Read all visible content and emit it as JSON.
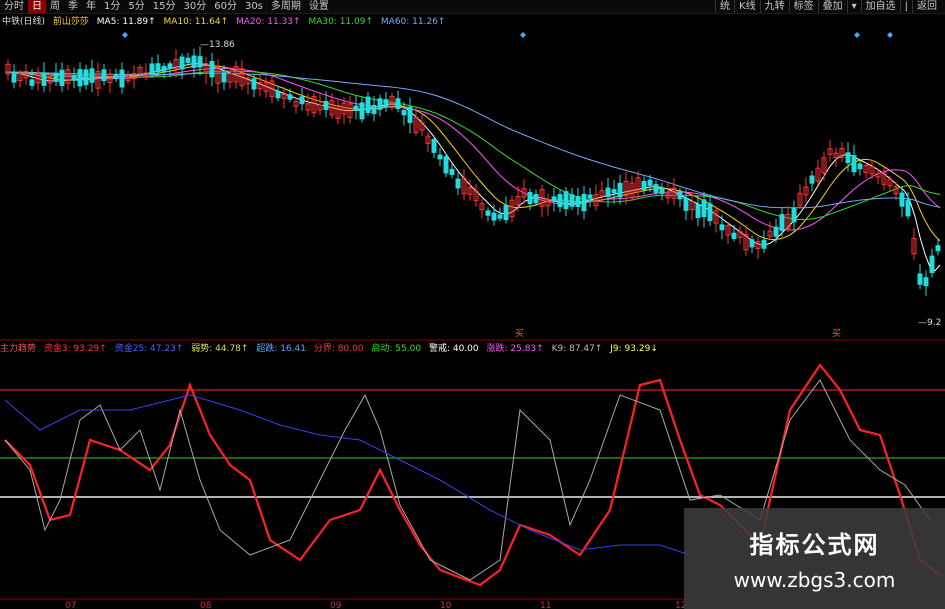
{
  "toolbar": {
    "items": [
      "分时",
      "日",
      "周",
      "季",
      "年",
      "1分",
      "5分",
      "15分",
      "30分",
      "60分",
      "30s",
      "多周期",
      "设置"
    ],
    "active_index": 1,
    "right_items": [
      "统",
      "K线",
      "九转",
      "标签",
      "叠加",
      "▾",
      "加自选",
      "|",
      "返回"
    ]
  },
  "main_legend": {
    "title": "中铁(日线)",
    "indicator": "前山莎莎",
    "ma": [
      {
        "label": "MA5: 11.89↑",
        "color": "#ffffff"
      },
      {
        "label": "MA10: 11.64↑",
        "color": "#ffd700"
      },
      {
        "label": "MA20: 11.33↑",
        "color": "#ff55ff"
      },
      {
        "label": "MA30: 11.09↑",
        "color": "#33dd33"
      },
      {
        "label": "MA60: 11.26↑",
        "color": "#77aaff"
      }
    ]
  },
  "price_labels": {
    "high": "13.86",
    "low": "9.2"
  },
  "markers": {
    "buy1": "买",
    "buy2": "买"
  },
  "sub_legend": {
    "title": "主力趋势",
    "items": [
      {
        "label": "资金3: 93.29↑",
        "color": "#ff3333"
      },
      {
        "label": "资金25: 47.23↑",
        "color": "#4466ff"
      },
      {
        "label": "弱势: 44.78↑",
        "color": "#dddd55"
      },
      {
        "label": "超跌: 16.41",
        "color": "#55aaff"
      },
      {
        "label": "分界: 80.00",
        "color": "#ff3333"
      },
      {
        "label": "启动: 55.00",
        "color": "#33dd33"
      },
      {
        "label": "警戒: 40.00",
        "color": "#ffffff"
      },
      {
        "label": "涨跌: 25.83↑",
        "color": "#ff55ff"
      },
      {
        "label": "K9: 87.47↑",
        "color": "#bbbbbb"
      },
      {
        "label": "J9: 93.29↓",
        "color": "#ffff55"
      }
    ]
  },
  "x_axis": [
    "07",
    "08",
    "09",
    "10",
    "11",
    "12"
  ],
  "watermark": {
    "title": "指标公式网",
    "url": "www.zbgs3.com"
  },
  "colors": {
    "bull": "#ff3333",
    "bear": "#22dddd",
    "grid": "#8b0000"
  }
}
